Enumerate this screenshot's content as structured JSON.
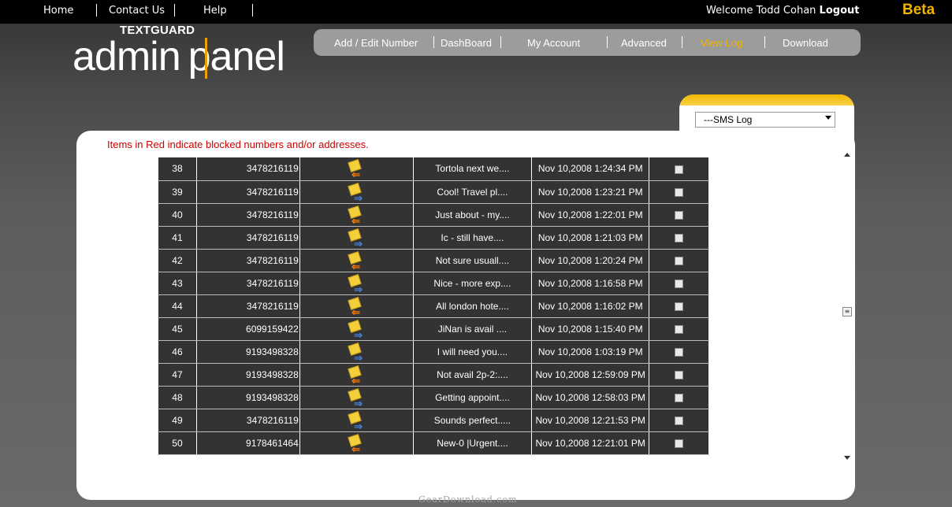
{
  "topnav": {
    "home": "Home",
    "contact": "Contact Us",
    "help": "Help",
    "welcome": "Welcome Todd Cohan",
    "logout": "Logout",
    "beta": "Beta"
  },
  "logo": {
    "top": "TEXTGUARD",
    "left": "admin",
    "right": "panel"
  },
  "mainnav": {
    "items": [
      {
        "label": "Add / Edit Number"
      },
      {
        "label": "DashBoard"
      },
      {
        "label": "My Account"
      },
      {
        "label": "Advanced"
      },
      {
        "label": "View Log"
      },
      {
        "label": "Download"
      }
    ],
    "active": "View Log"
  },
  "log_select": {
    "value": "---SMS Log"
  },
  "notice": "Items in Red indicate blocked numbers and/or addresses.",
  "rows": [
    {
      "no": "38",
      "number": "3478216119",
      "dir": "in",
      "msg": "Tortola next we....",
      "date": "Nov 10,2008 1:24:34 PM"
    },
    {
      "no": "39",
      "number": "3478216119",
      "dir": "out",
      "msg": "Cool! Travel pl....",
      "date": "Nov 10,2008 1:23:21 PM"
    },
    {
      "no": "40",
      "number": "3478216119",
      "dir": "in",
      "msg": "Just about - my....",
      "date": "Nov 10,2008 1:22:01 PM"
    },
    {
      "no": "41",
      "number": "3478216119",
      "dir": "out",
      "msg": "Ic - still have....",
      "date": "Nov 10,2008 1:21:03 PM"
    },
    {
      "no": "42",
      "number": "3478216119",
      "dir": "in",
      "msg": "Not sure usuall....",
      "date": "Nov 10,2008 1:20:24 PM"
    },
    {
      "no": "43",
      "number": "3478216119",
      "dir": "out",
      "msg": "Nice - more exp....",
      "date": "Nov 10,2008 1:16:58 PM"
    },
    {
      "no": "44",
      "number": "3478216119",
      "dir": "in",
      "msg": "All london hote....",
      "date": "Nov 10,2008 1:16:02 PM"
    },
    {
      "no": "45",
      "number": "6099159422",
      "dir": "out",
      "msg": "JiNan is avail ....",
      "date": "Nov 10,2008 1:15:40 PM"
    },
    {
      "no": "46",
      "number": "9193498328",
      "dir": "out",
      "msg": "I will need you....",
      "date": "Nov 10,2008 1:03:19 PM"
    },
    {
      "no": "47",
      "number": "9193498328",
      "dir": "in",
      "msg": "Not avail 2p-2:....",
      "date": "Nov 10,2008 12:59:09 PM"
    },
    {
      "no": "48",
      "number": "9193498328",
      "dir": "out",
      "msg": "Getting appoint....",
      "date": "Nov 10,2008 12:58:03 PM"
    },
    {
      "no": "49",
      "number": "3478216119",
      "dir": "out",
      "msg": "Sounds perfect.....",
      "date": "Nov 10,2008 12:21:53 PM"
    },
    {
      "no": "50",
      "number": "9178461464",
      "dir": "in",
      "msg": "New-0 |Urgent....",
      "date": "Nov 10,2008 12:21:01 PM"
    }
  ],
  "footer_mark": "GearDownload.com",
  "colors": {
    "accent": "#f0b400",
    "notice": "#cc0000",
    "row_bg": "#333333"
  }
}
